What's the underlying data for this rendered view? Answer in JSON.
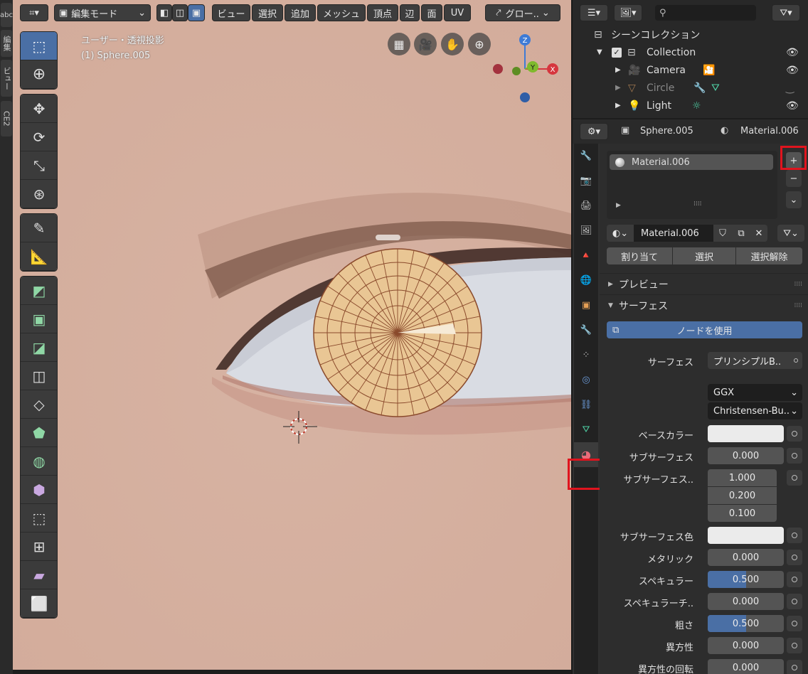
{
  "left_tabs": [
    "abc",
    "編集",
    "ビュー",
    "CE2"
  ],
  "viewport_header": {
    "editor_icon": "editor-type-icon",
    "mode": "編集モード",
    "menus": [
      "ビュー",
      "選択",
      "追加",
      "メッシュ",
      "頂点",
      "辺",
      "面",
      "UV"
    ],
    "transform_orientation": "グロー..",
    "overlay_text_line1": "ユーザー・透視投影",
    "overlay_text_line2": "(1) Sphere.005"
  },
  "gizmo": {
    "z": "Z",
    "y": "Y",
    "x": "X"
  },
  "outliner": {
    "search_placeholder": "",
    "scene_collection": "シーンコレクション",
    "rows": [
      {
        "name": "Collection"
      },
      {
        "name": "Camera"
      },
      {
        "name": "Circle"
      },
      {
        "name": "Light"
      }
    ]
  },
  "properties": {
    "object_name": "Sphere.005",
    "material_name_header": "Material.006",
    "slot_name": "Material.006",
    "datablock_name": "Material.006",
    "assign": "割り当て",
    "select": "選択",
    "deselect": "選択解除",
    "preview_panel": "プレビュー",
    "surface_panel": "サーフェス",
    "use_nodes": "ノードを使用",
    "surface_label": "サーフェス",
    "surface_value": "プリンシプルB..",
    "distribution": "GGX",
    "subsurface_method": "Christensen-Bu..",
    "fields": [
      {
        "label": "ベースカラー",
        "value": ""
      },
      {
        "label": "サブサーフェス",
        "value": "0.000"
      },
      {
        "label": "サブサーフェス..",
        "value": "1.000"
      },
      {
        "label": "",
        "value": "0.200"
      },
      {
        "label": "",
        "value": "0.100"
      },
      {
        "label": "サブサーフェス色",
        "value": ""
      },
      {
        "label": "メタリック",
        "value": "0.000"
      },
      {
        "label": "スペキュラー",
        "value": "0.500"
      },
      {
        "label": "スペキュラーチ..",
        "value": "0.000"
      },
      {
        "label": "粗さ",
        "value": "0.500"
      },
      {
        "label": "異方性",
        "value": "0.000"
      },
      {
        "label": "異方性の回転",
        "value": "0.000"
      }
    ],
    "specular_fill": 0.5,
    "roughness_fill": 0.5
  },
  "colors": {
    "accent": "#4a6fa5",
    "highlight": "#e0141e",
    "material_icon": "#e86c7a"
  }
}
